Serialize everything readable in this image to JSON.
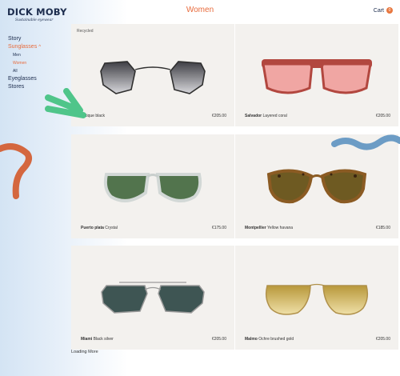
{
  "header": {
    "brand_name": "DICK MOBY",
    "brand_tagline": "Sustainable eyewear",
    "page_title": "Women",
    "cart_label": "Cart",
    "cart_count": "0"
  },
  "nav": {
    "story": "Story",
    "sunglasses": "Sunglasses",
    "men": "Men",
    "women": "Women",
    "all": "All",
    "eyeglasses": "Eyeglasses",
    "stores": "Stores"
  },
  "products": [
    {
      "tag": "Recycled",
      "name": "",
      "variant": "Antique black",
      "price": "€205.00",
      "frame": "#3b3b3b",
      "lens": "#6f6f74"
    },
    {
      "tag": "",
      "name": "Salvador",
      "variant": "Layered coral",
      "price": "€205.00",
      "frame": "#b2473f",
      "lens": "#f0a6a3"
    },
    {
      "tag": "",
      "name": "Puerto plata",
      "variant": "Crystal",
      "price": "€175.00",
      "frame": "#d9dedd",
      "lens": "#52744d"
    },
    {
      "tag": "",
      "name": "Montpellier",
      "variant": "Yellow havana",
      "price": "€185.00",
      "frame": "#8a5a22",
      "lens": "#7a6a2a"
    },
    {
      "tag": "",
      "name": "Miami",
      "variant": "Black silver",
      "price": "€205.00",
      "frame": "#9a9a9a",
      "lens": "#3e5553"
    },
    {
      "tag": "",
      "name": "Malmo",
      "variant": "Ochre brushed gold",
      "price": "€205.00",
      "frame": "#b0914a",
      "lens": "#d2b66a"
    }
  ],
  "footer": {
    "loading_label": "Loading More"
  },
  "colors": {
    "accent": "#e86b3c",
    "navy": "#1c2c4d",
    "card_bg": "#f3f1ee",
    "green_deco": "#4fc58a",
    "blue_deco": "#6c9cc5",
    "orange_deco": "#d4673f"
  }
}
